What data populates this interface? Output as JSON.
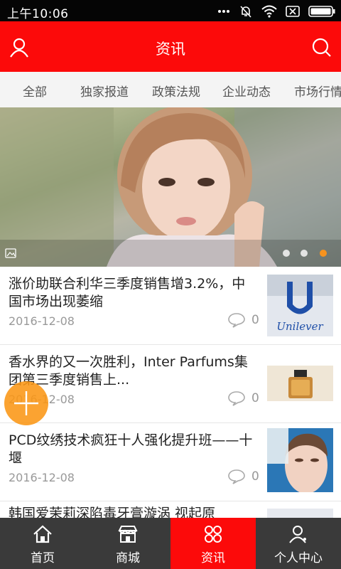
{
  "status_bar": {
    "time": "上午10:06"
  },
  "header": {
    "title": "资讯",
    "accent": "#fc0a0a"
  },
  "tabs": [
    "全部",
    "独家报道",
    "政策法规",
    "企业动态",
    "市场行情"
  ],
  "banner": {
    "slide_count": 3,
    "active_slide": 3,
    "active_dot_color": "#f7931e"
  },
  "news": [
    {
      "title": "涨价助联合利华三季度销售增3.2%，中国市场出现萎缩",
      "date": "2016-12-08",
      "comments": "0",
      "thumb_text": "Unilever"
    },
    {
      "title": "香水界的又一次胜利，Inter Parfums集团第三季度销售上...",
      "date": "2016-12-08",
      "comments": "0"
    },
    {
      "title": "PCD纹绣技术疯狂十人强化提升班——十堰",
      "date": "2016-12-08",
      "comments": "0"
    },
    {
      "title": "韩国爱茉莉深陷毒牙膏漩涡 视起原"
    }
  ],
  "bottom_nav": [
    {
      "label": "首页",
      "icon": "home-icon"
    },
    {
      "label": "商城",
      "icon": "store-icon"
    },
    {
      "label": "资讯",
      "icon": "news-icon",
      "active": true
    },
    {
      "label": "个人中心",
      "icon": "profile-icon"
    }
  ]
}
